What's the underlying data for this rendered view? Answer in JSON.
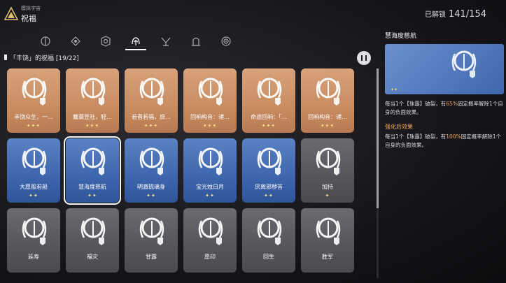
{
  "header": {
    "subtitle": "模拟宇宙",
    "title": "祝福",
    "unlocked_label": "已解锁",
    "unlocked_value": "141/154"
  },
  "tabs": [
    {
      "name": "tab-path-1",
      "icon": "path-emblem-icon"
    },
    {
      "name": "tab-path-2",
      "icon": "path-emblem-icon"
    },
    {
      "name": "tab-path-3",
      "icon": "path-emblem-icon"
    },
    {
      "name": "tab-abundance",
      "icon": "abundance-emblem-icon",
      "active": true
    },
    {
      "name": "tab-path-5",
      "icon": "path-emblem-icon"
    },
    {
      "name": "tab-path-6",
      "icon": "path-emblem-icon"
    },
    {
      "name": "tab-path-7",
      "icon": "path-emblem-icon"
    }
  ],
  "list_header": "「丰饶」的祝福 [19/22]",
  "cards": [
    {
      "name": "丰饶众生，一...",
      "rarity": "gold",
      "stars": "✦✦✦"
    },
    {
      "name": "戴蓑笠社，轻...",
      "rarity": "gold",
      "stars": "✦✦✦"
    },
    {
      "name": "若晋若福，庶...",
      "rarity": "gold",
      "stars": "✦✦✦"
    },
    {
      "name": "回响构音：诸...",
      "rarity": "gold",
      "stars": "✦✦✦"
    },
    {
      "name": "命途回响：「...",
      "rarity": "gold",
      "stars": "✦✦✦"
    },
    {
      "name": "回响构音：诸...",
      "rarity": "gold",
      "stars": "✦✦✦"
    },
    {
      "name": "大愿般若船",
      "rarity": "blue",
      "stars": "✦✦"
    },
    {
      "name": "慧海度慈航",
      "rarity": "blue",
      "stars": "✦✦",
      "selected": true
    },
    {
      "name": "明澈琉璃身",
      "rarity": "blue",
      "stars": "✦✦"
    },
    {
      "name": "宝光烛日月",
      "rarity": "blue",
      "stars": "✦✦"
    },
    {
      "name": "厌离邪秽苦",
      "rarity": "blue",
      "stars": "✦✦"
    },
    {
      "name": "加持",
      "rarity": "gray",
      "stars": "✦"
    },
    {
      "name": "延寿",
      "rarity": "gray",
      "stars": ""
    },
    {
      "name": "福灾",
      "rarity": "gray",
      "stars": ""
    },
    {
      "name": "甘露",
      "rarity": "gray",
      "stars": ""
    },
    {
      "name": "愿印",
      "rarity": "gray",
      "stars": ""
    },
    {
      "name": "回生",
      "rarity": "gray",
      "stars": ""
    },
    {
      "name": "胜军",
      "rarity": "gray",
      "stars": ""
    }
  ],
  "detail": {
    "title": "慧海度慈航",
    "stars": "✦✦",
    "desc_pre": "每当1个【珠露】破裂，有",
    "desc_pct": "65%",
    "desc_post": "固定概率解除1个自身的负面效果。",
    "enhanced_label": "强化后效果",
    "enh_pre": "每当1个【珠露】破裂，有",
    "enh_pct": "100%",
    "enh_post": "固定概率解除1个自身的负面效果。"
  },
  "colors": {
    "gold_card": "#c98c62",
    "blue_card": "#3d66ad",
    "gray_card": "#55555b",
    "accent_orange": "#f3a55c",
    "star_yellow": "#ffe08a"
  }
}
